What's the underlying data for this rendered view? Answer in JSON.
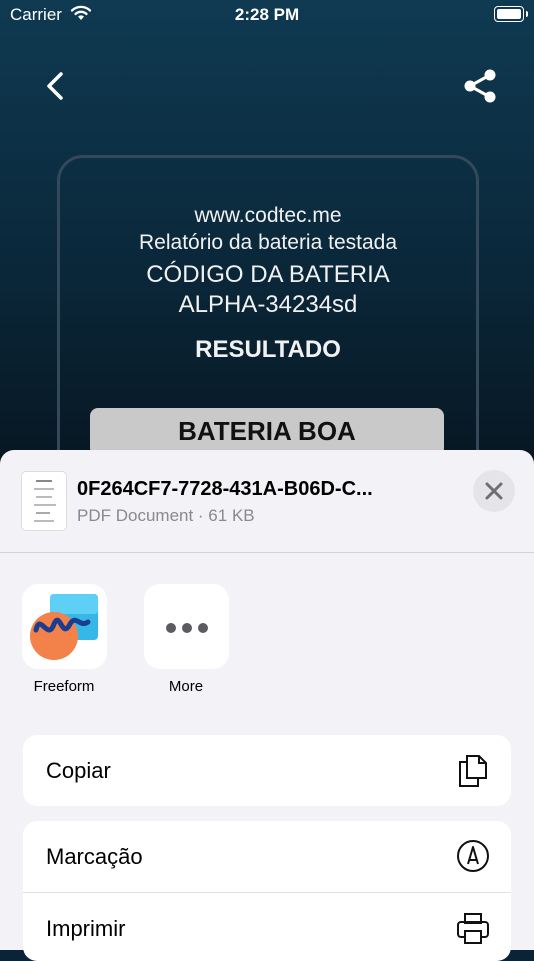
{
  "status_bar": {
    "carrier": "Carrier",
    "time": "2:28 PM"
  },
  "card": {
    "website": "www.codtec.me",
    "subtitle": "Relatório da bateria testada",
    "code_label": "CÓDIGO DA BATERIA",
    "code_value": "ALPHA-34234sd",
    "result_label": "RESULTADO",
    "result_value": "BATERIA BOA"
  },
  "share_sheet": {
    "file_name": "0F264CF7-7728-431A-B06D-C...",
    "file_meta": "PDF Document · 61 KB",
    "apps": [
      {
        "label": "Freeform",
        "icon": "freeform-icon"
      },
      {
        "label": "More",
        "icon": "more-icon"
      }
    ],
    "actions": [
      {
        "label": "Copiar",
        "icon": "copy-icon"
      },
      {
        "label": "Marcação",
        "icon": "markup-icon"
      },
      {
        "label": "Imprimir",
        "icon": "print-icon"
      }
    ]
  },
  "colors": {
    "accent_bg": "#0a2336",
    "sheet_bg": "#f2f2f7",
    "pill_bg": "#c9c9c9"
  }
}
